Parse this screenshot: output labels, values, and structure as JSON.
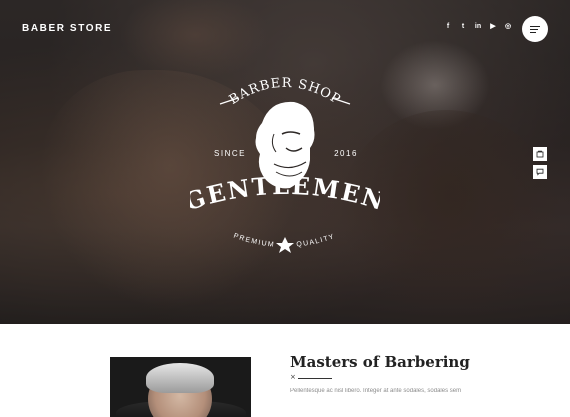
{
  "brand": {
    "name": "BABER STORE"
  },
  "social": [
    {
      "icon": "facebook-icon",
      "glyph": "f"
    },
    {
      "icon": "twitter-icon",
      "glyph": "t"
    },
    {
      "icon": "linkedin-icon",
      "glyph": "in"
    },
    {
      "icon": "youtube-icon",
      "glyph": "▶"
    },
    {
      "icon": "instagram-icon",
      "glyph": "◎"
    }
  ],
  "menu": {
    "icon": "hamburger-menu-icon"
  },
  "side_tools": [
    {
      "icon": "cart-icon"
    },
    {
      "icon": "chat-icon"
    }
  ],
  "hero_logo": {
    "arc_top": "BARBER SHOP",
    "since": "SINCE",
    "year": "2016",
    "name": "GENTLEMEN",
    "tag_left": "PREMIUM",
    "tag_right": "QUALITY"
  },
  "section": {
    "title": "Masters of Barbering",
    "divider_mark": "×",
    "paragraph": "Pellentesque ac nisl libero. Integer at ante sodales, sodales sem"
  },
  "colors": {
    "text_dark": "#222222",
    "muted": "#8c8c8c",
    "white": "#ffffff"
  }
}
